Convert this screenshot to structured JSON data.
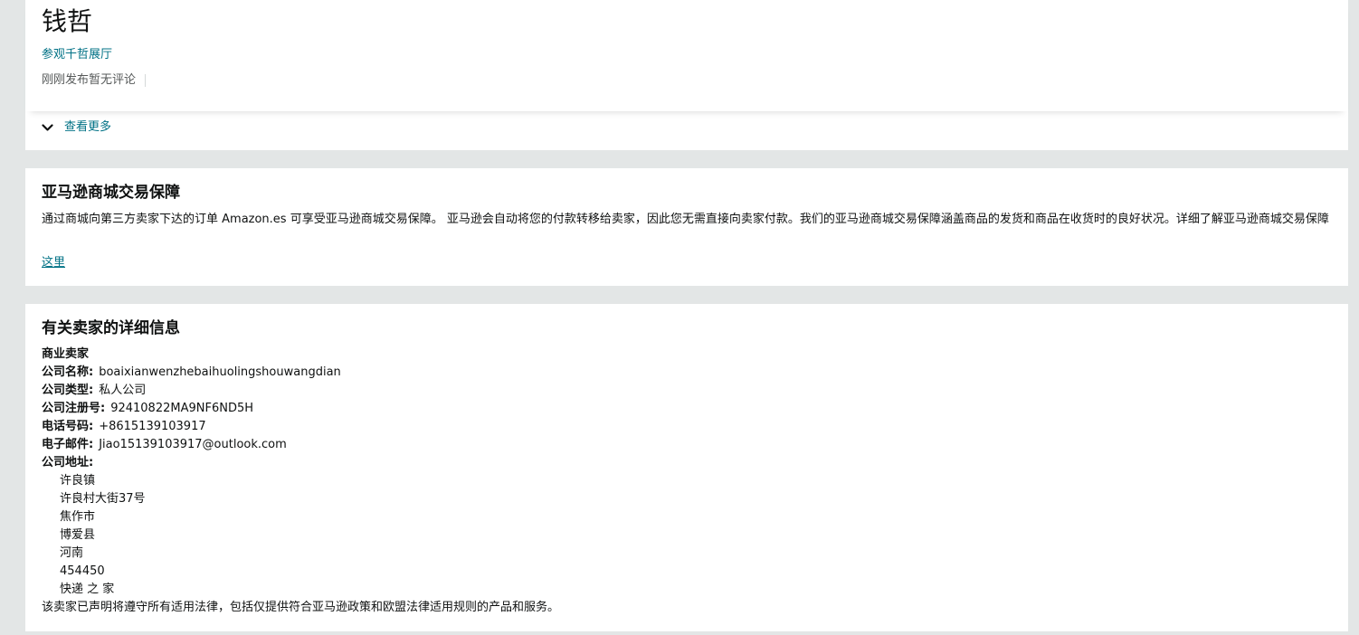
{
  "seller": {
    "name": "钱哲",
    "storefront_link": "参观千哲展厅",
    "rating_text": "刚刚发布暂无评论",
    "see_more": "查看更多"
  },
  "guarantee": {
    "title": "亚马逊商城交易保障",
    "text": "通过商城向第三方卖家下达的订单 Amazon.es 可享受亚马逊商城交易保障。 亚马逊会自动将您的付款转移给卖家，因此您无需直接向卖家付款。我们的亚马逊商城交易保障涵盖商品的发货和商品在收货时的良好状况。详细了解亚马逊商城交易保障",
    "link": "这里"
  },
  "details": {
    "title": "有关卖家的详细信息",
    "seller_type": "商业卖家",
    "company_name_label": "公司名称:",
    "company_name": "boaixianwenzhebaihuolingshouwangdian",
    "company_type_label": "公司类型:",
    "company_type": "私人公司",
    "registration_label": "公司注册号:",
    "registration": "92410822MA9NF6ND5H",
    "phone_label": "电话号码:",
    "phone": "+8615139103917",
    "email_label": "电子邮件:",
    "email": "Jiao15139103917@outlook.com",
    "address_label": "公司地址:",
    "address_lines": [
      "许良镇",
      "许良村大街37号",
      "焦作市",
      "博爱县",
      "河南",
      "454450",
      "快递 之 家"
    ],
    "disclaimer": "该卖家已声明将遵守所有适用法律，包括仅提供符合亚马逊政策和欧盟法律适用规则的产品和服务。"
  },
  "colors": {
    "link": "#007185",
    "page_bg": "#e3e6e6",
    "card_bg": "#ffffff",
    "muted_text": "#565959"
  },
  "icons": {
    "see_more": "chevron-down-icon"
  }
}
